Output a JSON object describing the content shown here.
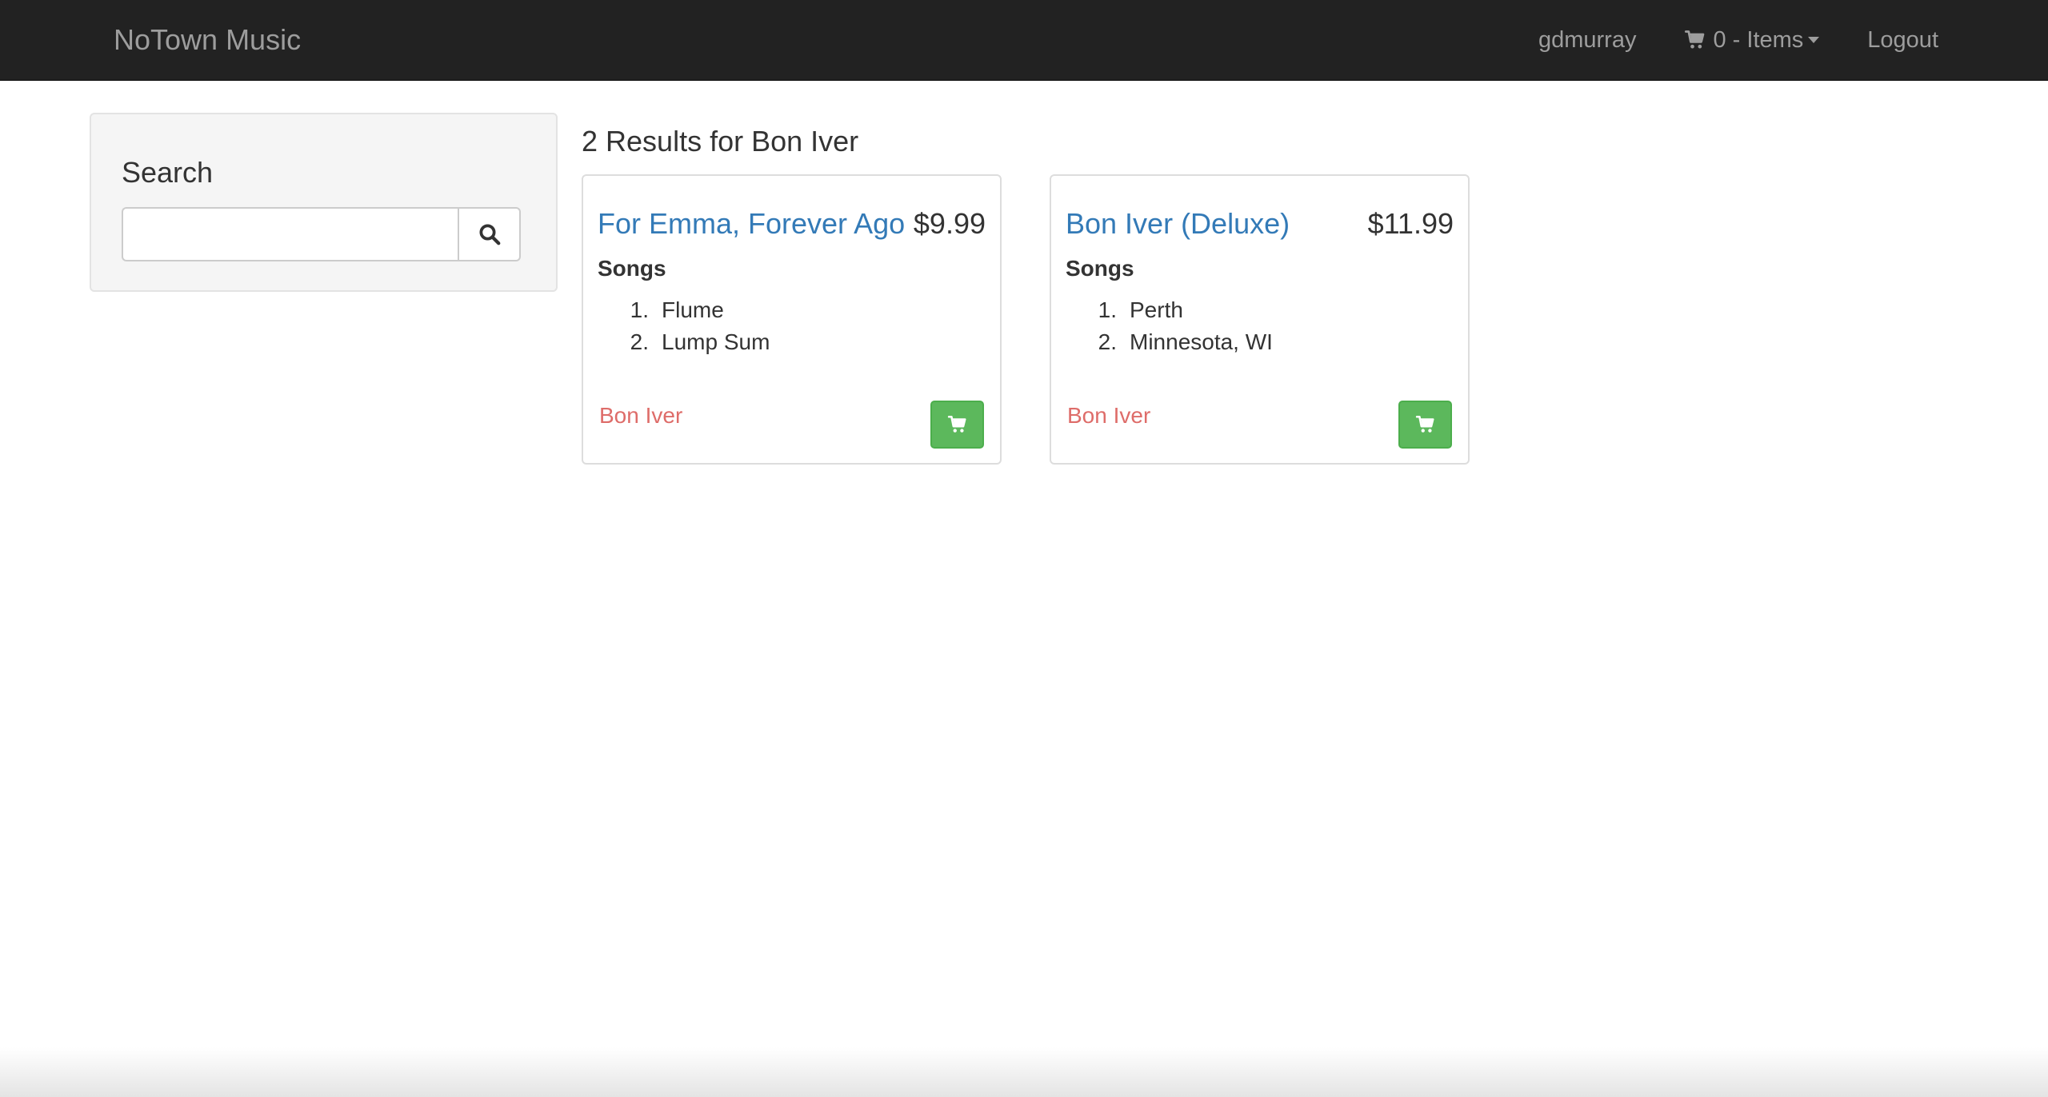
{
  "navbar": {
    "brand": "NoTown Music",
    "username": "gdmurray",
    "cart_label": "0 - Items",
    "logout_label": "Logout"
  },
  "sidebar": {
    "title": "Search",
    "search_value": "",
    "search_placeholder": ""
  },
  "results": {
    "heading": "2 Results for Bon Iver",
    "albums": [
      {
        "title": "For Emma, Forever Ago",
        "price": "$9.99",
        "songs_label": "Songs",
        "songs": [
          {
            "num": "1.",
            "name": "Flume"
          },
          {
            "num": "2.",
            "name": "Lump Sum"
          }
        ],
        "artist": "Bon Iver"
      },
      {
        "title": "Bon Iver (Deluxe)",
        "price": "$11.99",
        "songs_label": "Songs",
        "songs": [
          {
            "num": "1.",
            "name": "Perth"
          },
          {
            "num": "2.",
            "name": "Minnesota, WI"
          }
        ],
        "artist": "Bon Iver"
      }
    ]
  },
  "colors": {
    "navbar_bg": "#222222",
    "link_blue": "#337ab7",
    "artist_red": "#d9534f",
    "button_green": "#5cb85c"
  },
  "icons": {
    "cart": "shopping-cart-icon",
    "search": "magnifier-icon",
    "caret": "caret-down-icon"
  }
}
